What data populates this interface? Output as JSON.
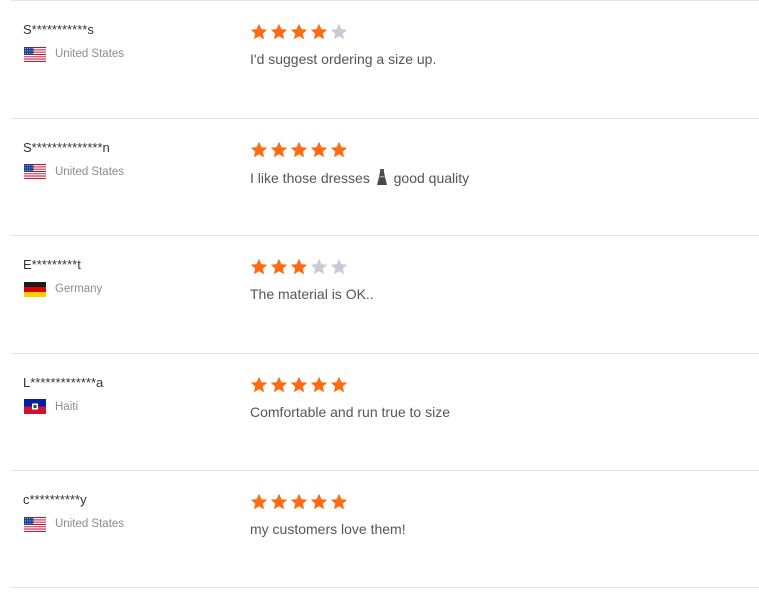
{
  "colors": {
    "star_filled": "#ff6a14",
    "star_empty": "#c8ccd4",
    "divider": "#e3e3e3"
  },
  "reviews": [
    {
      "buyer": "S***********s",
      "country": "United States",
      "flag_icon": "us-flag-icon",
      "rating": 4,
      "comment_before": "I'd suggest ordering a size up.",
      "comment_after": ""
    },
    {
      "buyer": "S**************n",
      "country": "United States",
      "flag_icon": "us-flag-icon",
      "rating": 5,
      "comment_before": "I like those dresses",
      "comment_after": "good quality",
      "emoji_icon": "dress-icon"
    },
    {
      "buyer": "E*********t",
      "country": "Germany",
      "flag_icon": "de-flag-icon",
      "rating": 3,
      "comment_before": "The material is OK..",
      "comment_after": ""
    },
    {
      "buyer": "L*************a",
      "country": "Haiti",
      "flag_icon": "ht-flag-icon",
      "rating": 5,
      "comment_before": "Comfortable and run true to size",
      "comment_after": ""
    },
    {
      "buyer": "c**********y",
      "country": "United States",
      "flag_icon": "us-flag-icon",
      "rating": 5,
      "comment_before": "my customers love them!",
      "comment_after": ""
    }
  ]
}
